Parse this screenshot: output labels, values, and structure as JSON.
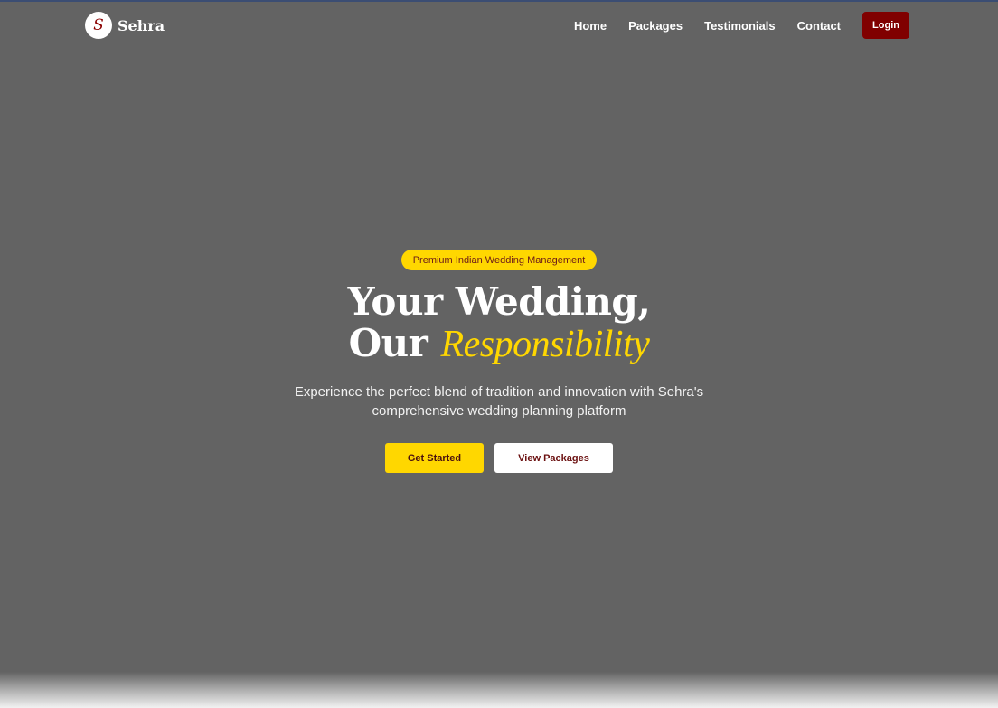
{
  "colors": {
    "background": "#636363",
    "accent_gold": "#ffd700",
    "accent_maroon": "#800000",
    "text_white": "#ffffff"
  },
  "logo": {
    "initial": "S",
    "name": "Sehra"
  },
  "nav": {
    "links": [
      "Home",
      "Packages",
      "Testimonials",
      "Contact"
    ],
    "login_label": "Login"
  },
  "hero": {
    "badge": "Premium Indian Wedding Management",
    "title_line1": "Your Wedding,",
    "title_line2_plain": "Our ",
    "title_line2_accent": "Responsibility",
    "subtitle": "Experience the perfect blend of tradition and innovation with Sehra's comprehensive wedding planning platform",
    "primary_button": "Get Started",
    "secondary_button": "View Packages"
  }
}
